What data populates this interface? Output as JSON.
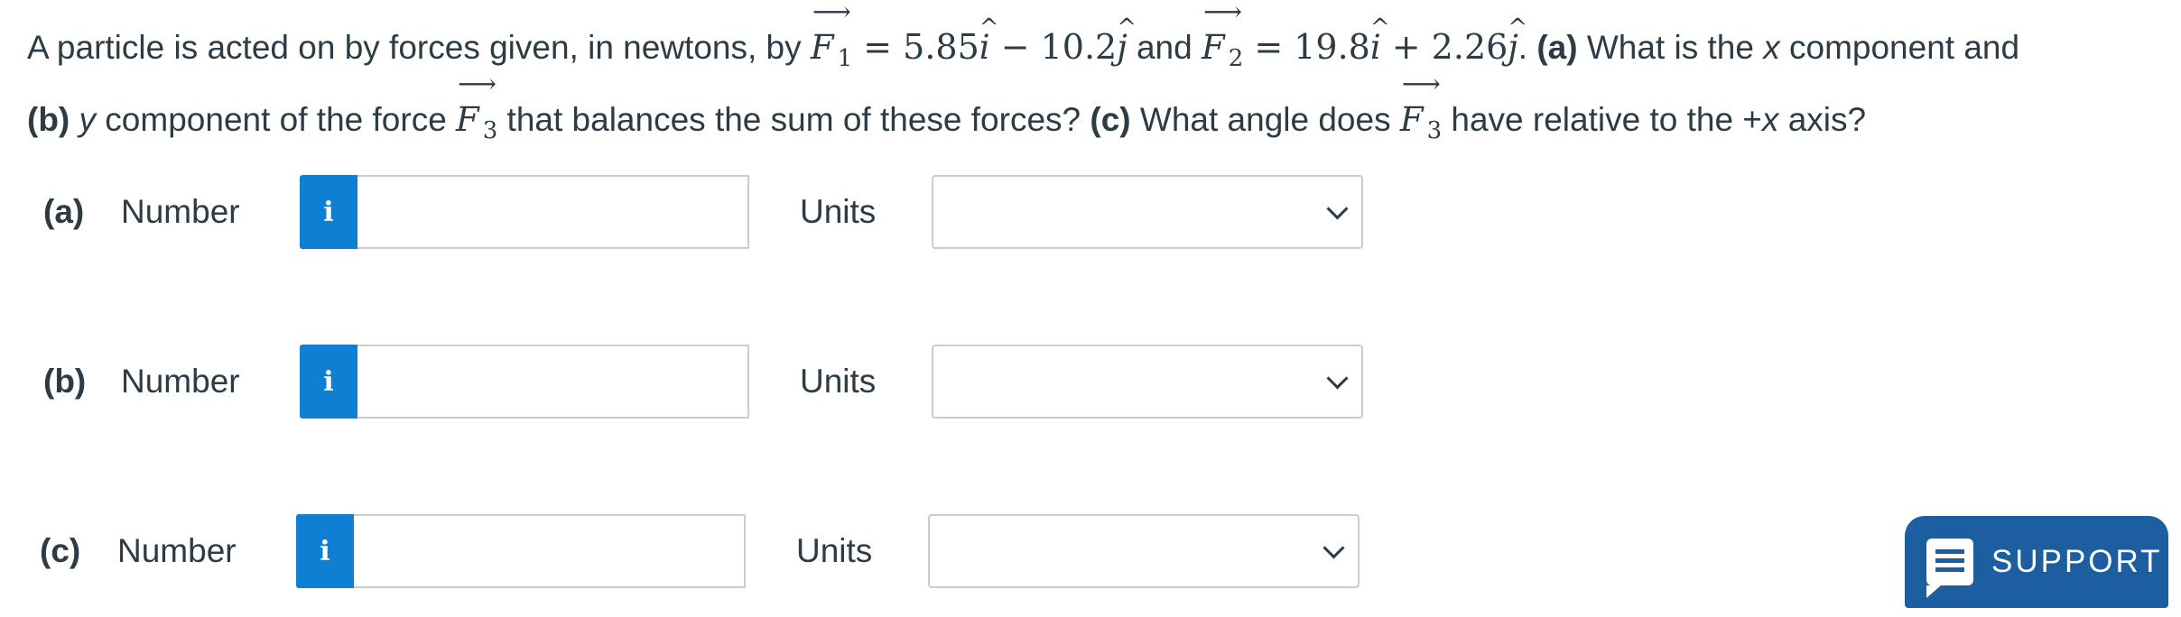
{
  "question": {
    "intro": "A particle is acted on by forces given, in newtons, by ",
    "f_symbol": "F",
    "f1_sub": "1",
    "f1_eq_a": " = 5.85",
    "i_hat": "i",
    "f1_eq_b": " − 10.2",
    "j_hat": "j",
    "and": " and ",
    "f2_sub": "2",
    "f2_eq_a": " = 19.8",
    "f2_eq_b": " + 2.26",
    "period": ". ",
    "part_a_label": "(a)",
    "text_a": " What is the ",
    "x_var": "x",
    "text_a2": " component and",
    "part_b_label": "(b)",
    "y_var": "y",
    "text_b": " component of the force ",
    "f3_sub": "3",
    "text_b2": " that balances the sum of these forces? ",
    "part_c_label": "(c)",
    "text_c": " What angle does ",
    "text_c2": " have relative to the +",
    "text_c3": " axis?"
  },
  "rows": [
    {
      "part": "(a)",
      "number_label": "Number",
      "info_icon": "i",
      "units_label": "Units",
      "value": "",
      "units_value": ""
    },
    {
      "part": "(b)",
      "number_label": "Number",
      "info_icon": "i",
      "units_label": "Units",
      "value": "",
      "units_value": ""
    },
    {
      "part": "(c)",
      "number_label": "Number",
      "info_icon": "i",
      "units_label": "Units",
      "value": "",
      "units_value": ""
    }
  ],
  "support": {
    "label": "SUPPORT",
    "icon": "chat-icon"
  },
  "colors": {
    "info_button": "#0e7fd3",
    "support_button": "#1c5ea0",
    "text": "#2d3b45"
  }
}
